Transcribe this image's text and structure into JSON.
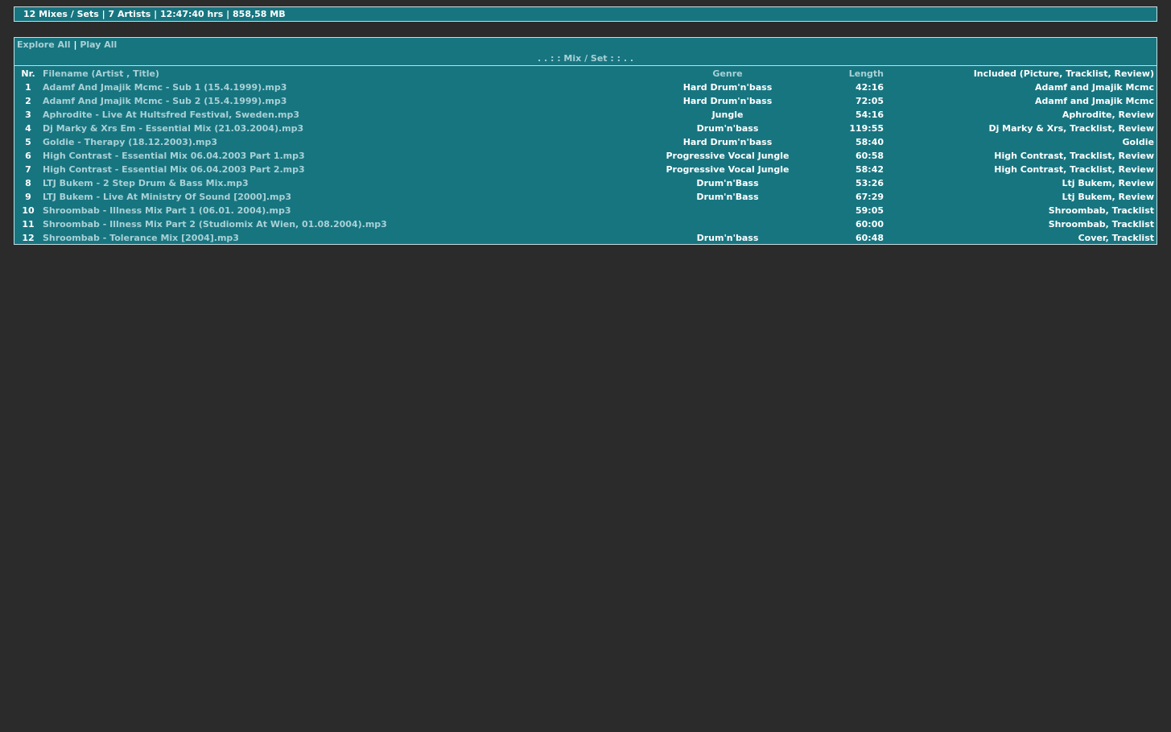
{
  "summary": "12 Mixes / Sets | 7 Artists | 12:47:40 hrs | 858,58 MB",
  "actions": {
    "explore_all": "Explore All",
    "separator": "|",
    "play_all": "Play All"
  },
  "section_title": ". . : : Mix / Set : : . .",
  "columns": {
    "nr": "Nr.",
    "filename": "Filename (Artist , Title)",
    "genre": "Genre",
    "length": "Length",
    "included": "Included (Picture, Tracklist, Review)"
  },
  "rows": [
    {
      "nr": "1",
      "file": "Adamf And Jmajik Mcmc - Sub 1 (15.4.1999).mp3",
      "genre": "Hard Drum'n'bass",
      "length": "42:16",
      "included": "Adamf and Jmajik Mcmc"
    },
    {
      "nr": "2",
      "file": "Adamf And Jmajik Mcmc - Sub 2 (15.4.1999).mp3",
      "genre": "Hard Drum'n'bass",
      "length": "72:05",
      "included": "Adamf and Jmajik Mcmc"
    },
    {
      "nr": "3",
      "file": "Aphrodite - Live At Hultsfred Festival, Sweden.mp3",
      "genre": "Jungle",
      "length": "54:16",
      "included": "Aphrodite, Review"
    },
    {
      "nr": "4",
      "file": "Dj Marky & Xrs Em - Essential Mix (21.03.2004).mp3",
      "genre": "Drum'n'bass",
      "length": "119:55",
      "included": "Dj Marky & Xrs, Tracklist, Review"
    },
    {
      "nr": "5",
      "file": "Goldie - Therapy (18.12.2003).mp3",
      "genre": "Hard Drum'n'bass",
      "length": "58:40",
      "included": "Goldie"
    },
    {
      "nr": "6",
      "file": "High Contrast - Essential Mix 06.04.2003 Part 1.mp3",
      "genre": "Progressive Vocal Jungle",
      "length": "60:58",
      "included": "High Contrast, Tracklist, Review"
    },
    {
      "nr": "7",
      "file": "High Contrast - Essential Mix 06.04.2003 Part 2.mp3",
      "genre": "Progressive Vocal Jungle",
      "length": "58:42",
      "included": "High Contrast, Tracklist, Review"
    },
    {
      "nr": "8",
      "file": "LTJ Bukem - 2 Step Drum & Bass Mix.mp3",
      "genre": "Drum'n'Bass",
      "length": "53:26",
      "included": "Ltj Bukem, Review"
    },
    {
      "nr": "9",
      "file": "LTJ Bukem - Live At Ministry Of Sound [2000].mp3",
      "genre": "Drum'n'Bass",
      "length": "67:29",
      "included": "Ltj Bukem, Review"
    },
    {
      "nr": "10",
      "file": "Shroombab - Illness Mix Part 1 (06.01. 2004).mp3",
      "genre": "",
      "length": "59:05",
      "included": "Shroombab, Tracklist"
    },
    {
      "nr": "11",
      "file": "Shroombab - Illness Mix Part 2 (Studiomix At Wien, 01.08.2004).mp3",
      "genre": "",
      "length": "60:00",
      "included": "Shroombab, Tracklist"
    },
    {
      "nr": "12",
      "file": "Shroombab - Tolerance Mix [2004].mp3",
      "genre": "Drum'n'bass",
      "length": "60:48",
      "included": "Cover, Tracklist"
    }
  ]
}
